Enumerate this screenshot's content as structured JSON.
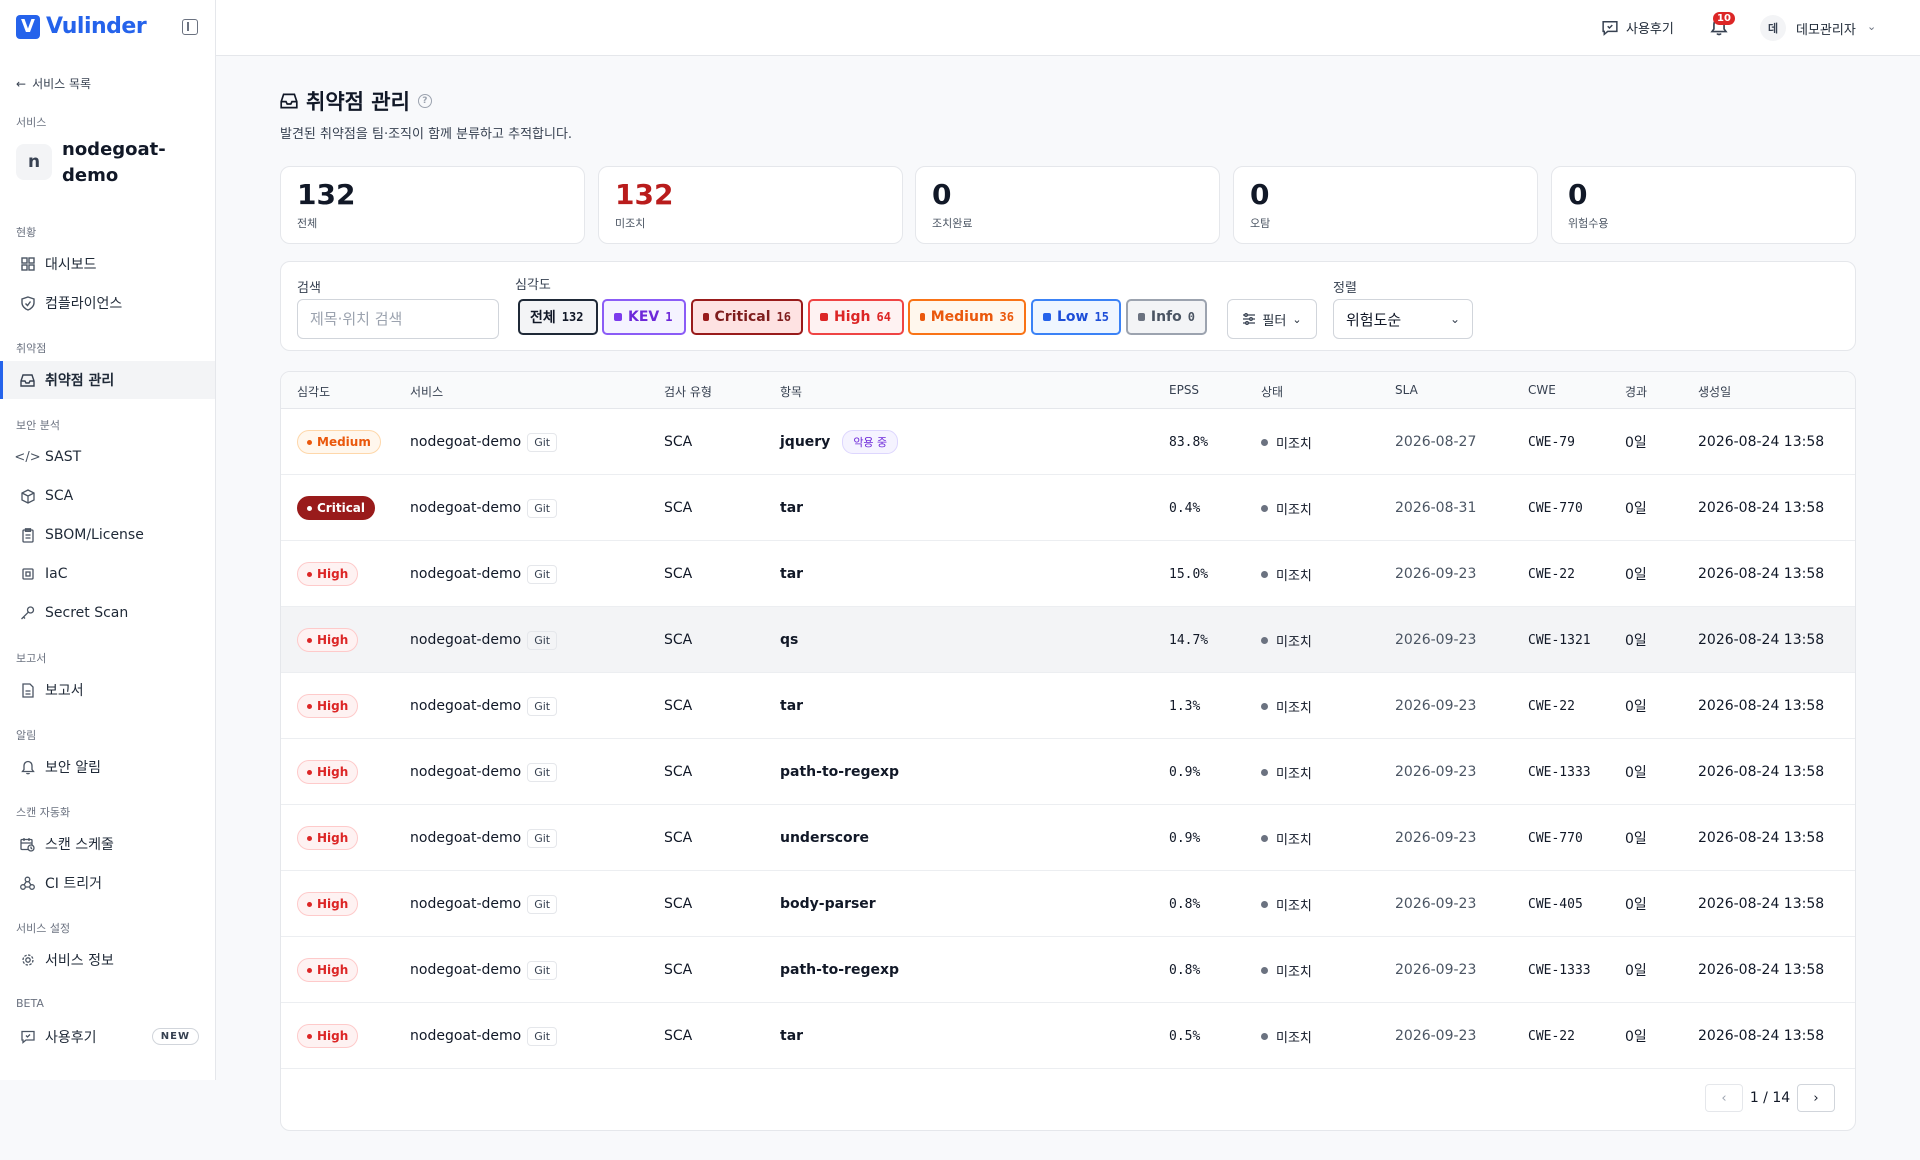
{
  "app": {
    "logo_mark": "V",
    "logo_text": "Vulinder"
  },
  "sidebar": {
    "back_label": "서비스 목록",
    "service_section": "서비스",
    "service_avatar": "n",
    "service_name": "nodegoat-demo",
    "sections": {
      "status": "현황",
      "vuln": "취약점",
      "analysis": "보안 분석",
      "report": "보고서",
      "alert": "알림",
      "automation": "스캔 자동화",
      "settings": "서비스 설정",
      "beta": "BETA"
    },
    "items": {
      "dashboard": "대시보드",
      "compliance": "컴플라이언스",
      "vuln_mgmt": "취약점 관리",
      "sast": "SAST",
      "sca": "SCA",
      "sbom": "SBOM/License",
      "iac": "IaC",
      "secret": "Secret Scan",
      "report": "보고서",
      "alert": "보안 알림",
      "schedule": "스캔 스케줄",
      "ci": "CI 트리거",
      "svc_info": "서비스 정보",
      "review": "사용후기"
    },
    "new_badge": "NEW"
  },
  "header": {
    "review_label": "사용후기",
    "notification_count": "10",
    "user_avatar": "데",
    "user_name": "데모관리자"
  },
  "page": {
    "title": "취약점 관리",
    "subtitle": "발견된 취약점을 팀·조직이 함께 분류하고 추적합니다."
  },
  "stats": [
    {
      "value": "132",
      "label": "전체"
    },
    {
      "value": "132",
      "label": "미조치"
    },
    {
      "value": "0",
      "label": "조치완료"
    },
    {
      "value": "0",
      "label": "오탐"
    },
    {
      "value": "0",
      "label": "위험수용"
    }
  ],
  "filters": {
    "search_label": "검색",
    "search_placeholder": "제목·위치 검색",
    "severity_label": "심각도",
    "chips": [
      {
        "label": "전체",
        "count": "132"
      },
      {
        "label": "KEV",
        "count": "1"
      },
      {
        "label": "Critical",
        "count": "16"
      },
      {
        "label": "High",
        "count": "64"
      },
      {
        "label": "Medium",
        "count": "36"
      },
      {
        "label": "Low",
        "count": "15"
      },
      {
        "label": "Info",
        "count": "0"
      }
    ],
    "filter_button": "필터",
    "sort_label": "정렬",
    "sort_value": "위험도순"
  },
  "table": {
    "columns": [
      "심각도",
      "서비스",
      "검사 유형",
      "항목",
      "EPSS",
      "상태",
      "SLA",
      "CWE",
      "경과",
      "생성일"
    ],
    "git_label": "Git",
    "in_use_label": "악용 중",
    "rows": [
      {
        "severity": "Medium",
        "service": "nodegoat-demo",
        "type": "SCA",
        "item": "jquery",
        "epss": "83.8%",
        "status": "미조치",
        "sla": "2026-08-27",
        "cwe": "CWE-79",
        "elapsed": "0일",
        "created": "2026-08-24 13:58"
      },
      {
        "severity": "Critical",
        "service": "nodegoat-demo",
        "type": "SCA",
        "item": "tar",
        "epss": "0.4%",
        "status": "미조치",
        "sla": "2026-08-31",
        "cwe": "CWE-770",
        "elapsed": "0일",
        "created": "2026-08-24 13:58"
      },
      {
        "severity": "High",
        "service": "nodegoat-demo",
        "type": "SCA",
        "item": "tar",
        "epss": "15.0%",
        "status": "미조치",
        "sla": "2026-09-23",
        "cwe": "CWE-22",
        "elapsed": "0일",
        "created": "2026-08-24 13:58"
      },
      {
        "severity": "High",
        "service": "nodegoat-demo",
        "type": "SCA",
        "item": "qs",
        "epss": "14.7%",
        "status": "미조치",
        "sla": "2026-09-23",
        "cwe": "CWE-1321",
        "elapsed": "0일",
        "created": "2026-08-24 13:58"
      },
      {
        "severity": "High",
        "service": "nodegoat-demo",
        "type": "SCA",
        "item": "tar",
        "epss": "1.3%",
        "status": "미조치",
        "sla": "2026-09-23",
        "cwe": "CWE-22",
        "elapsed": "0일",
        "created": "2026-08-24 13:58"
      },
      {
        "severity": "High",
        "service": "nodegoat-demo",
        "type": "SCA",
        "item": "path-to-regexp",
        "epss": "0.9%",
        "status": "미조치",
        "sla": "2026-09-23",
        "cwe": "CWE-1333",
        "elapsed": "0일",
        "created": "2026-08-24 13:58"
      },
      {
        "severity": "High",
        "service": "nodegoat-demo",
        "type": "SCA",
        "item": "underscore",
        "epss": "0.9%",
        "status": "미조치",
        "sla": "2026-09-23",
        "cwe": "CWE-770",
        "elapsed": "0일",
        "created": "2026-08-24 13:58"
      },
      {
        "severity": "High",
        "service": "nodegoat-demo",
        "type": "SCA",
        "item": "body-parser",
        "epss": "0.8%",
        "status": "미조치",
        "sla": "2026-09-23",
        "cwe": "CWE-405",
        "elapsed": "0일",
        "created": "2026-08-24 13:58"
      },
      {
        "severity": "High",
        "service": "nodegoat-demo",
        "type": "SCA",
        "item": "path-to-regexp",
        "epss": "0.8%",
        "status": "미조치",
        "sla": "2026-09-23",
        "cwe": "CWE-1333",
        "elapsed": "0일",
        "created": "2026-08-24 13:58"
      },
      {
        "severity": "High",
        "service": "nodegoat-demo",
        "type": "SCA",
        "item": "tar",
        "epss": "0.5%",
        "status": "미조치",
        "sla": "2026-09-23",
        "cwe": "CWE-22",
        "elapsed": "0일",
        "created": "2026-08-24 13:58"
      }
    ]
  },
  "pagination": {
    "text": "1 / 14",
    "prev": "‹",
    "next": "›"
  },
  "colors": {
    "accent": "#2563eb",
    "critical": "#991b1b",
    "high": "#dc2626",
    "medium": "#ea580c",
    "low": "#2563eb",
    "kev": "#7c3aed",
    "info": "#6b7280"
  }
}
